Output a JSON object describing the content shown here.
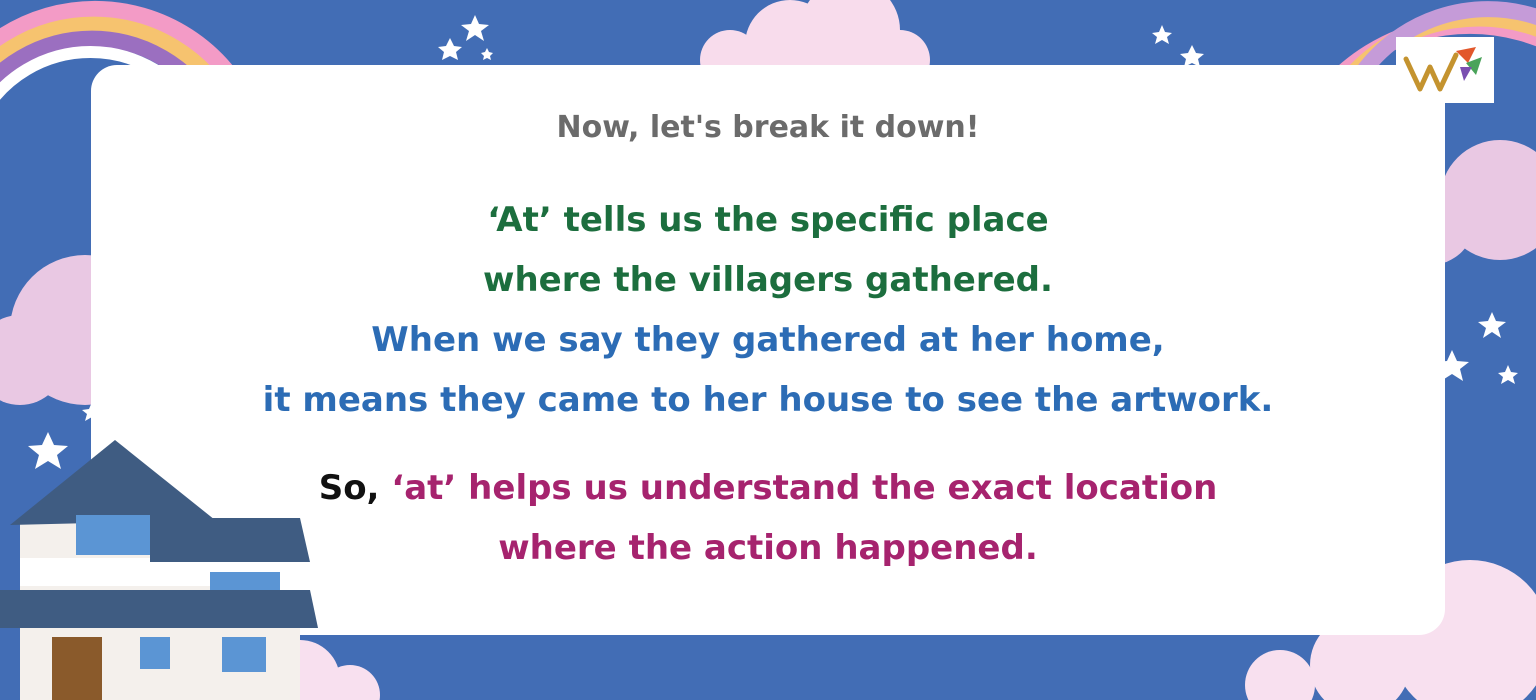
{
  "intro": "Now, let's break it down!",
  "lines": [
    "‘At’ tells us the specific place",
    "where the villagers gathered.",
    "When we say they gathered at her home,",
    "it means they came to her house to see the artwork."
  ],
  "summary": {
    "prefix": "So,",
    "highlight": "‘at’ helps us understand the exact location",
    "line2": "where the action happened."
  },
  "icons": [
    "rainbow-icon",
    "star-icon",
    "cloud-icon",
    "house-icon",
    "logo-icon"
  ],
  "colors": {
    "background": "#426db5",
    "card": "#ffffff",
    "intro": "#6b6b6b",
    "green": "#1c6e3e",
    "blue": "#2c6cb5",
    "magenta": "#a6236e",
    "black": "#111111"
  }
}
